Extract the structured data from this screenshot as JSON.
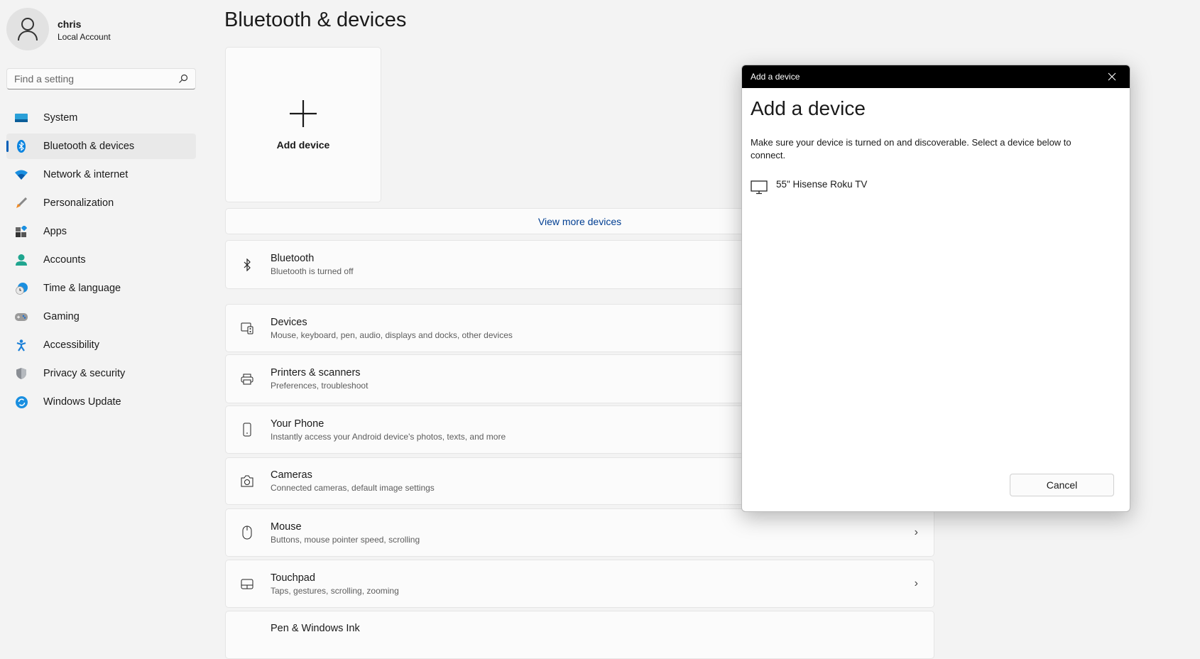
{
  "user": {
    "name": "chris",
    "type": "Local Account"
  },
  "search": {
    "placeholder": "Find a setting"
  },
  "nav": [
    {
      "label": "System",
      "icon": "system-icon"
    },
    {
      "label": "Bluetooth & devices",
      "icon": "bluetooth-icon",
      "selected": true
    },
    {
      "label": "Network & internet",
      "icon": "wifi-icon"
    },
    {
      "label": "Personalization",
      "icon": "brush-icon"
    },
    {
      "label": "Apps",
      "icon": "apps-icon"
    },
    {
      "label": "Accounts",
      "icon": "person-icon"
    },
    {
      "label": "Time & language",
      "icon": "clock-globe-icon"
    },
    {
      "label": "Gaming",
      "icon": "gamepad-icon"
    },
    {
      "label": "Accessibility",
      "icon": "accessibility-icon"
    },
    {
      "label": "Privacy & security",
      "icon": "shield-icon"
    },
    {
      "label": "Windows Update",
      "icon": "update-icon"
    }
  ],
  "page": {
    "title": "Bluetooth & devices",
    "add_device": "Add device",
    "view_more": "View more devices"
  },
  "rows": [
    {
      "title": "Bluetooth",
      "subtitle": "Bluetooth is turned off"
    },
    {
      "title": "Devices",
      "subtitle": "Mouse, keyboard, pen, audio, displays and docks, other devices"
    },
    {
      "title": "Printers & scanners",
      "subtitle": "Preferences, troubleshoot"
    },
    {
      "title": "Your Phone",
      "subtitle": "Instantly access your Android device's photos, texts, and more"
    },
    {
      "title": "Cameras",
      "subtitle": "Connected cameras, default image settings"
    },
    {
      "title": "Mouse",
      "subtitle": "Buttons, mouse pointer speed, scrolling"
    },
    {
      "title": "Touchpad",
      "subtitle": "Taps, gestures, scrolling, zooming"
    },
    {
      "title": "Pen & Windows Ink",
      "subtitle": ""
    }
  ],
  "dialog": {
    "window_title": "Add a device",
    "heading": "Add a device",
    "instructions": "Make sure your device is turned on and discoverable. Select a device below to connect.",
    "devices": [
      {
        "name": "55\" Hisense Roku TV",
        "icon": "monitor-icon"
      }
    ],
    "cancel": "Cancel"
  },
  "colors": {
    "accent": "#005fb8",
    "link": "#003e92"
  }
}
